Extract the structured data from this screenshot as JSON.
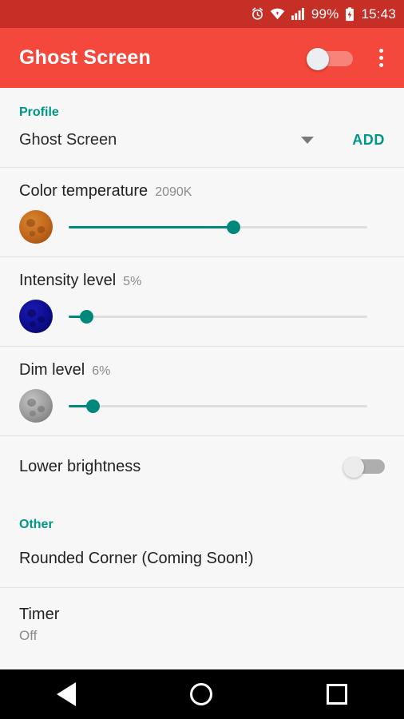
{
  "status_bar": {
    "alarm_icon": "alarm-clock-icon",
    "wifi_icon": "wifi-icon",
    "signal_icon": "cellular-signal-icon",
    "battery_percent": "99%",
    "battery_icon": "battery-charging-icon",
    "time": "15:43",
    "background": "#c62f26"
  },
  "app_bar": {
    "title": "Ghost Screen",
    "background": "#f4483c",
    "master_switch": {
      "name": "master-toggle",
      "state": "off"
    },
    "overflow_menu": "more-options-icon"
  },
  "profile": {
    "section_label": "Profile",
    "selected": "Ghost Screen",
    "dropdown_icon": "chevron-down-icon",
    "add_label": "ADD"
  },
  "sliders": [
    {
      "name": "color-temperature",
      "label": "Color temperature",
      "value_text": "2090K",
      "percent": 55,
      "icon": "moon-orange-icon",
      "icon_color": "#c0651b"
    },
    {
      "name": "intensity-level",
      "label": "Intensity level",
      "value_text": "5%",
      "percent": 6,
      "icon": "moon-blue-icon",
      "icon_color": "#0d0d8c"
    },
    {
      "name": "dim-level",
      "label": "Dim level",
      "value_text": "6%",
      "percent": 8,
      "icon": "moon-gray-icon",
      "icon_color": "#9a9a9a"
    }
  ],
  "lower_brightness": {
    "label": "Lower brightness",
    "state": "off"
  },
  "other": {
    "section_label": "Other",
    "rounded_corner": "Rounded Corner (Coming Soon!)",
    "timer_title": "Timer",
    "timer_value": "Off"
  },
  "nav_bar": {
    "back": "back-icon",
    "home": "home-icon",
    "recents": "recents-icon"
  },
  "accent": {
    "teal": "#009688",
    "slider": "#00897b",
    "red": "#f4483c"
  }
}
